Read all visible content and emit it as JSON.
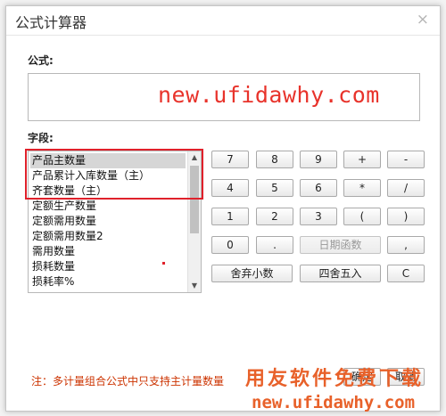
{
  "dialog": {
    "title": "公式计算器",
    "close_glyph": "×"
  },
  "formula": {
    "label": "公式:",
    "value": "new.ufidawhy.com"
  },
  "fields": {
    "label": "字段:",
    "items": [
      "产品主数量",
      "产品累计入库数量（主）",
      "齐套数量（主）",
      "定额生产数量",
      "定额需用数量",
      "定额需用数量2",
      "需用数量",
      "损耗数量",
      "损耗率%"
    ],
    "selected_index": 0
  },
  "keypad": {
    "k7": "7",
    "k8": "8",
    "k9": "9",
    "plus": "+",
    "minus": "-",
    "k4": "4",
    "k5": "5",
    "k6": "6",
    "multiply": "*",
    "divide": "/",
    "k1": "1",
    "k2": "2",
    "k3": "3",
    "lparen": "(",
    "rparen": ")",
    "k0": "0",
    "dot": ".",
    "date_func": "日期函数",
    "comma": ",",
    "round_off": "舍弃小数",
    "round_half": "四舍五入",
    "clear": "C"
  },
  "footer": {
    "note": "注：多计量组合公式中只支持主计量数量",
    "ok": "确定",
    "cancel": "取消"
  },
  "watermark": {
    "line1": "用友软件免费下载",
    "line2": "new.ufidawhy.com"
  },
  "colors": {
    "formula_text": "#e8332b",
    "highlight_border": "#e0212b",
    "note_text": "#cc3300",
    "watermark": "#e8612a"
  }
}
